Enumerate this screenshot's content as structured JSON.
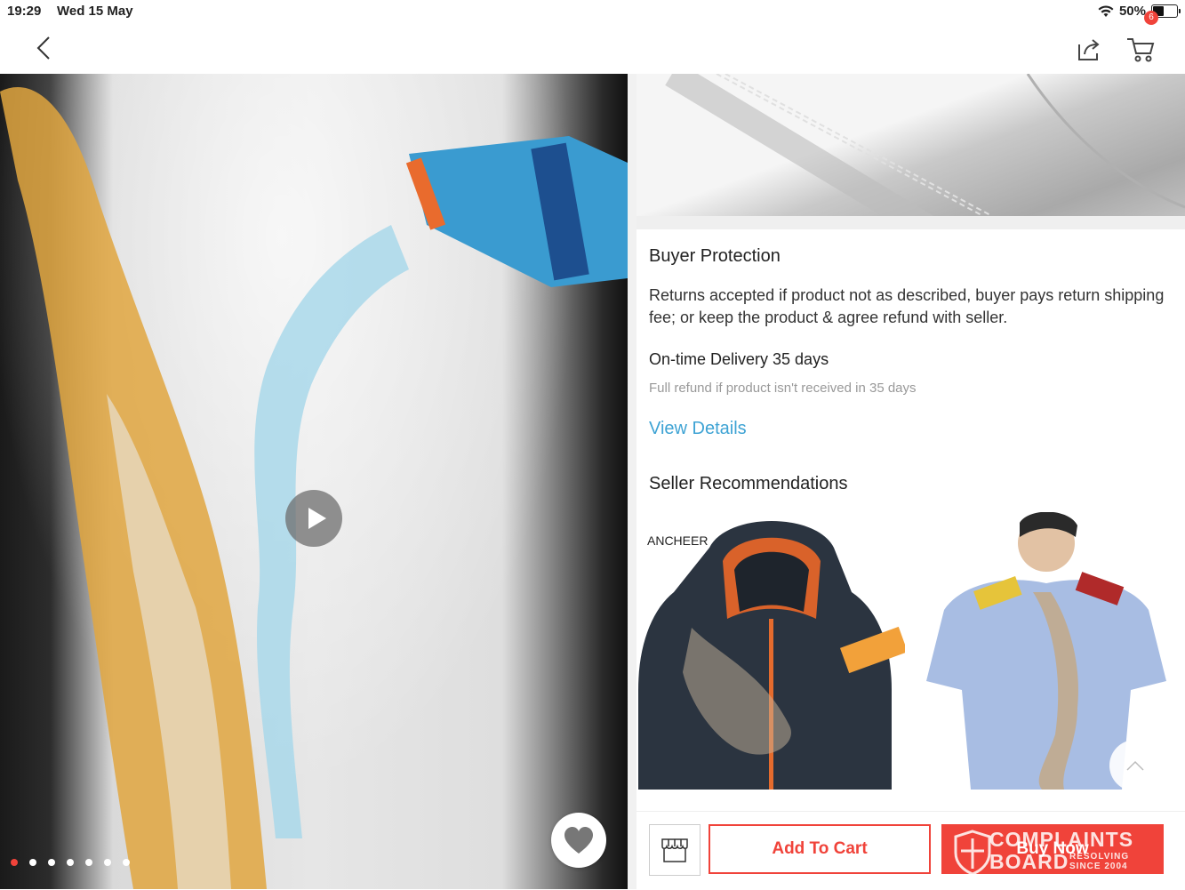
{
  "status_bar": {
    "time": "19:29",
    "date": "Wed 15 May",
    "battery": "50%"
  },
  "nav": {
    "cart_count": "6"
  },
  "gallery": {
    "slide_count": 7,
    "active_slide": 1
  },
  "buyer_protection": {
    "title": "Buyer Protection",
    "returns_text": "Returns accepted if product not as described, buyer pays return shipping fee; or keep the product & agree refund with seller.",
    "delivery_title": "On-time Delivery 35 days",
    "delivery_note": "Full refund if product isn't received in 35 days",
    "view_details": "View Details"
  },
  "recommendations": {
    "title": "Seller Recommendations",
    "items": [
      {
        "brand": "ANCHEER"
      },
      {
        "brand": ""
      }
    ]
  },
  "actions": {
    "add_to_cart": "Add To Cart",
    "buy_now": "Buy Now"
  },
  "watermark": {
    "line1": "COMPLAINTS",
    "line2": "BOARD",
    "line3": "RESOLVING",
    "line4": "SINCE 2004"
  },
  "colors": {
    "accent": "#f0433a",
    "link": "#3ea3d4"
  }
}
